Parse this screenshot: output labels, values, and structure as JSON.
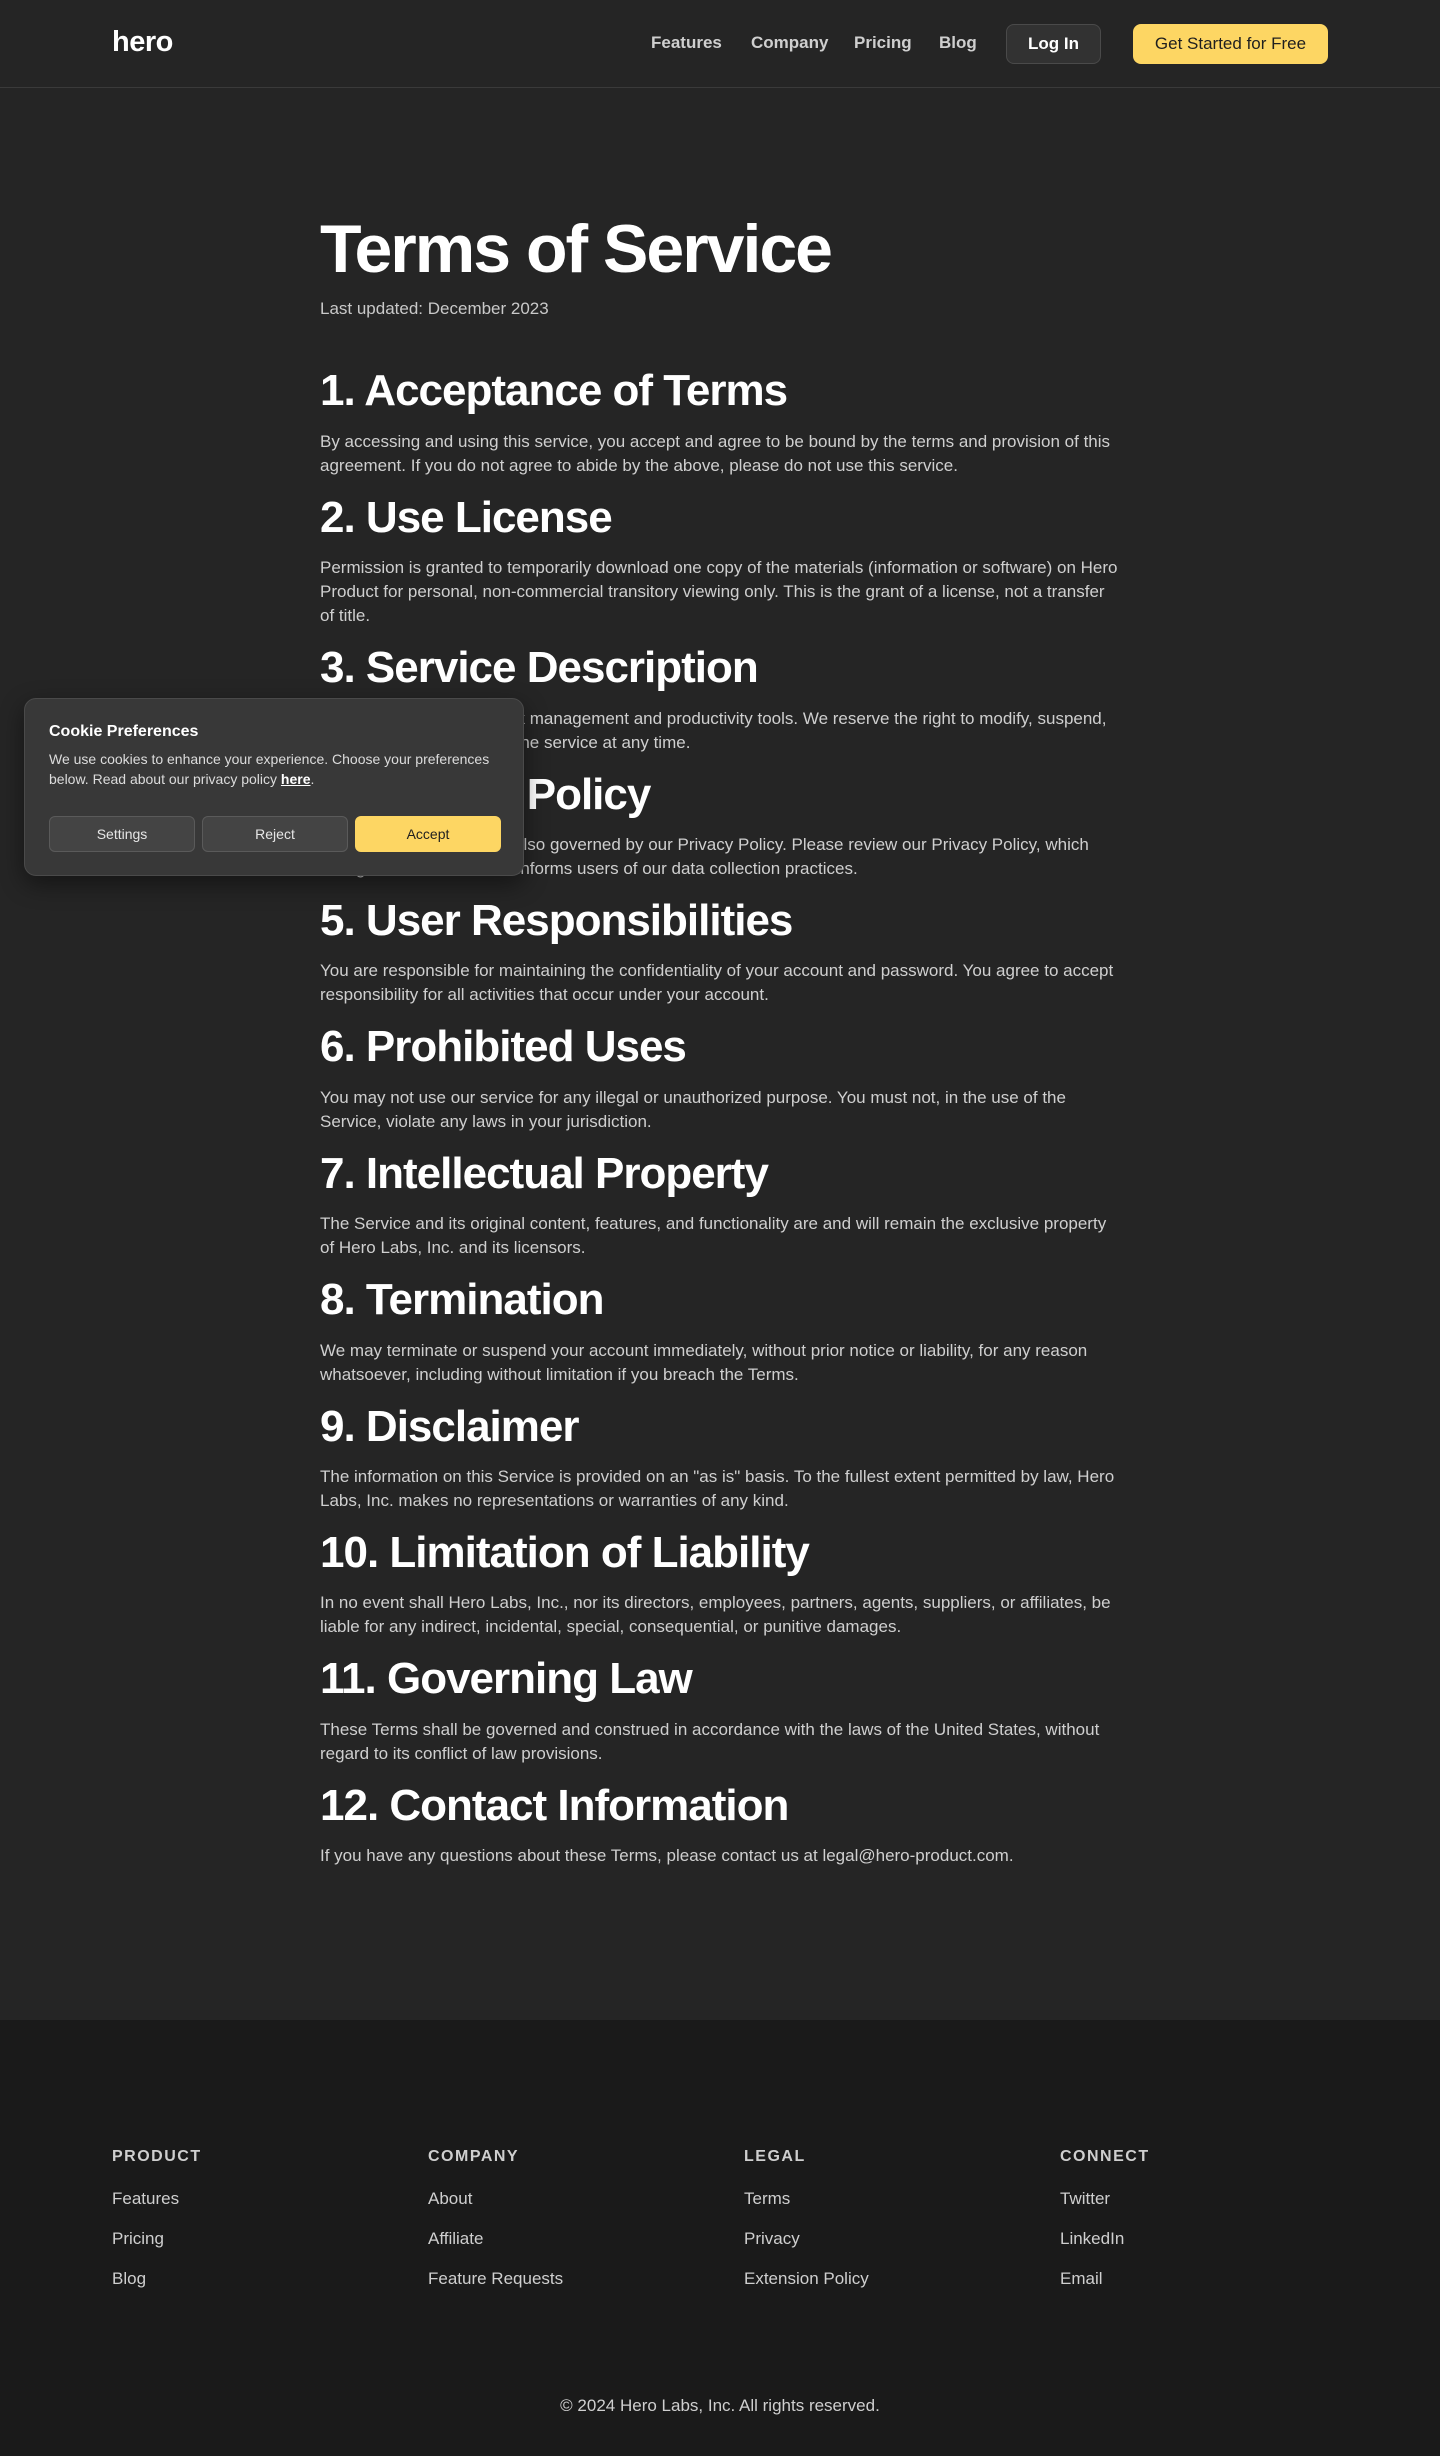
{
  "header": {
    "logo": "hero",
    "nav": [
      "Features",
      "Company",
      "Pricing",
      "Blog"
    ],
    "login_label": "Log In",
    "cta_label": "Get Started for Free"
  },
  "main": {
    "title": "Terms of Service",
    "updated": "Last updated: December 2023",
    "sections": [
      {
        "heading": "1. Acceptance of Terms",
        "body": "By accessing and using this service, you accept and agree to be bound by the terms and provision of this agreement. If you do not agree to abide by the above, please do not use this service."
      },
      {
        "heading": "2. Use License",
        "body": "Permission is granted to temporarily download one copy of the materials (information or software) on Hero Product for personal, non-commercial transitory viewing only. This is the grant of a license, not a transfer of title."
      },
      {
        "heading": "3. Service Description",
        "body": "Hero Product provides task management and productivity tools. We reserve the right to modify, suspend, or discontinue any part of the service at any time."
      },
      {
        "heading": "4. Privacy Policy",
        "body": "Your use of the service is also governed by our Privacy Policy. Please review our Privacy Policy, which also governs the Site and informs users of our data collection practices."
      },
      {
        "heading": "5. User Responsibilities",
        "body": "You are responsible for maintaining the confidentiality of your account and password. You agree to accept responsibility for all activities that occur under your account."
      },
      {
        "heading": "6. Prohibited Uses",
        "body": "You may not use our service for any illegal or unauthorized purpose. You must not, in the use of the Service, violate any laws in your jurisdiction."
      },
      {
        "heading": "7. Intellectual Property",
        "body": "The Service and its original content, features, and functionality are and will remain the exclusive property of Hero Labs, Inc. and its licensors."
      },
      {
        "heading": "8. Termination",
        "body": "We may terminate or suspend your account immediately, without prior notice or liability, for any reason whatsoever, including without limitation if you breach the Terms."
      },
      {
        "heading": "9. Disclaimer",
        "body": "The information on this Service is provided on an \"as is\" basis. To the fullest extent permitted by law, Hero Labs, Inc. makes no representations or warranties of any kind."
      },
      {
        "heading": "10. Limitation of Liability",
        "body": "In no event shall Hero Labs, Inc., nor its directors, employees, partners, agents, suppliers, or affiliates, be liable for any indirect, incidental, special, consequential, or punitive damages."
      },
      {
        "heading": "11. Governing Law",
        "body": "These Terms shall be governed and construed in accordance with the laws of the United States, without regard to its conflict of law provisions."
      },
      {
        "heading": "12. Contact Information",
        "body": "If you have any questions about these Terms, please contact us at legal@hero-product.com."
      }
    ]
  },
  "cookie": {
    "title": "Cookie Preferences",
    "text": "We use cookies to enhance your experience. Choose your preferences below. Read about our privacy policy ",
    "link": "here",
    "period": ".",
    "settings_label": "Settings",
    "reject_label": "Reject",
    "accept_label": "Accept"
  },
  "footer": {
    "columns": [
      {
        "heading": "PRODUCT",
        "links": [
          "Features",
          "Pricing",
          "Blog"
        ]
      },
      {
        "heading": "COMPANY",
        "links": [
          "About",
          "Affiliate",
          "Feature Requests"
        ]
      },
      {
        "heading": "LEGAL",
        "links": [
          "Terms",
          "Privacy",
          "Extension Policy"
        ]
      },
      {
        "heading": "CONNECT",
        "links": [
          "Twitter",
          "LinkedIn",
          "Email"
        ]
      }
    ],
    "copyright": "© 2024 Hero Labs, Inc. All rights reserved."
  },
  "colors": {
    "background": "#252525",
    "footer_background": "#1a1a1a",
    "accent": "#fdd663"
  }
}
